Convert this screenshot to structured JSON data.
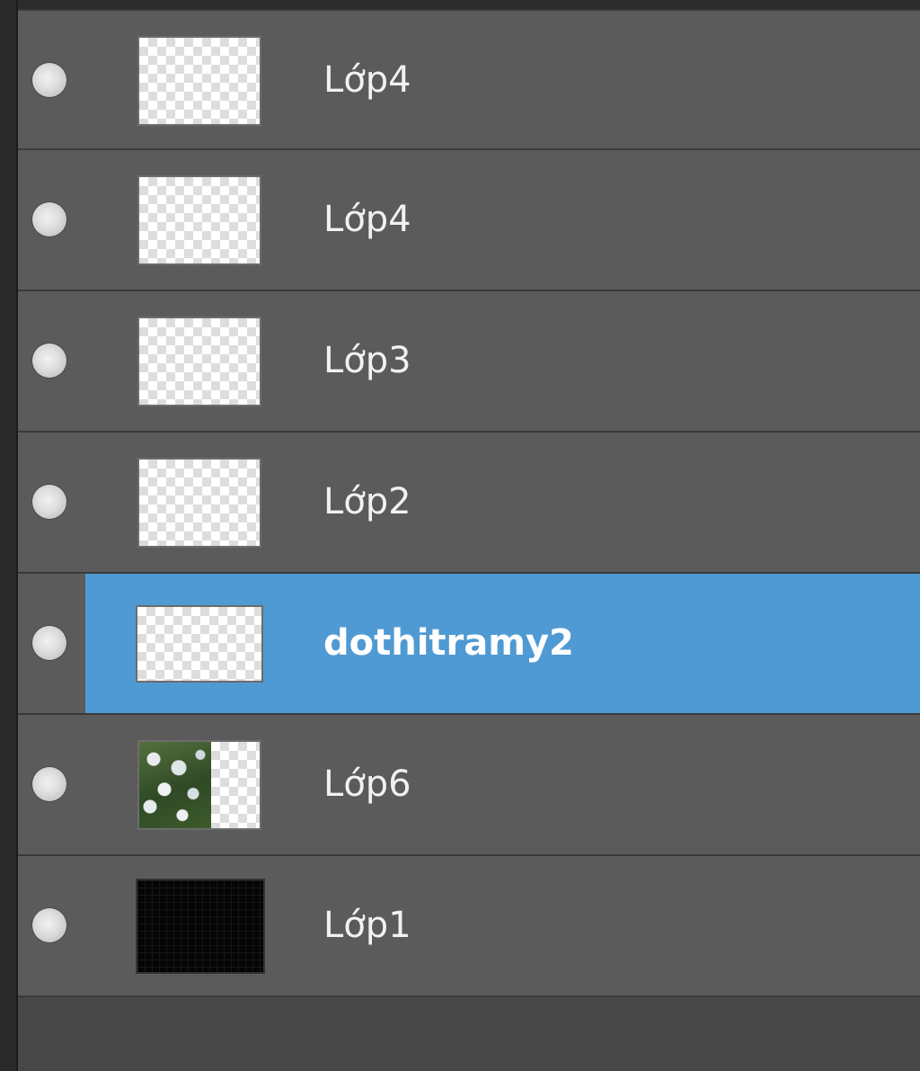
{
  "panel": {
    "name": "layers-panel"
  },
  "layers": [
    {
      "name": "Lớp4",
      "thumbnail": "transparent",
      "selected": false
    },
    {
      "name": "Lớp4",
      "thumbnail": "transparent",
      "selected": false
    },
    {
      "name": "Lớp3",
      "thumbnail": "transparent",
      "selected": false
    },
    {
      "name": "Lớp2",
      "thumbnail": "transparent",
      "selected": false
    },
    {
      "name": "dothitramy2",
      "thumbnail": "transparent",
      "selected": true
    },
    {
      "name": "Lớp6",
      "thumbnail": "photo-flowers",
      "selected": false
    },
    {
      "name": "Lớp1",
      "thumbnail": "black",
      "selected": false
    }
  ],
  "colors": {
    "row_bg": "#5b5b5b",
    "selection": "#509ad3",
    "panel_bg": "#474747",
    "text": "#f1f1f1"
  },
  "icons": {
    "visibility": "visibility-dot-icon"
  }
}
